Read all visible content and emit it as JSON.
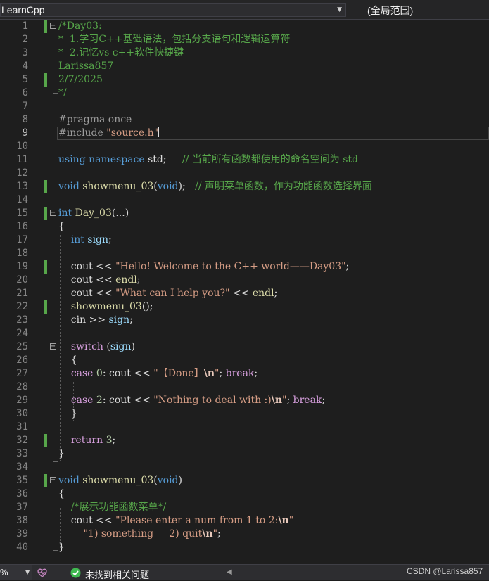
{
  "topbar": {
    "project_combo": "LearnCpp",
    "scope_combo": "(全局范围)"
  },
  "editor": {
    "lines": [
      {
        "n": "1",
        "spans": [
          [
            "cm",
            "/*Day03:"
          ]
        ]
      },
      {
        "n": "2",
        "spans": [
          [
            "cm",
            "*  1.学习C++基础语法，包括分支语句和逻辑运算符"
          ]
        ]
      },
      {
        "n": "3",
        "spans": [
          [
            "cm",
            "*  2.记忆vs c++软件快捷键"
          ]
        ]
      },
      {
        "n": "4",
        "spans": [
          [
            "cm",
            "Larissa857"
          ]
        ]
      },
      {
        "n": "5",
        "spans": [
          [
            "cm",
            "2/7/2025"
          ]
        ]
      },
      {
        "n": "6",
        "spans": [
          [
            "cm",
            "*/"
          ]
        ]
      },
      {
        "n": "7",
        "spans": []
      },
      {
        "n": "8",
        "spans": [
          [
            "pp",
            "#pragma once"
          ]
        ]
      },
      {
        "n": "9",
        "spans": [
          [
            "pp",
            "#include "
          ],
          [
            "str",
            "\"source.h\""
          ]
        ]
      },
      {
        "n": "10",
        "spans": []
      },
      {
        "n": "11",
        "spans": [
          [
            "kw",
            "using namespace "
          ],
          [
            "",
            "std;     "
          ],
          [
            "cm",
            "// 当前所有函数都使用的命名空间为 std"
          ]
        ]
      },
      {
        "n": "12",
        "spans": []
      },
      {
        "n": "13",
        "spans": [
          [
            "kw",
            "void "
          ],
          [
            "fn",
            "showmenu_03"
          ],
          [
            "",
            "("
          ],
          [
            "kw",
            "void"
          ],
          [
            "",
            ");   "
          ],
          [
            "cm",
            "// 声明菜单函数，作为功能函数选择界面"
          ]
        ]
      },
      {
        "n": "14",
        "spans": []
      },
      {
        "n": "15",
        "spans": [
          [
            "kw",
            "int "
          ],
          [
            "fn",
            "Day_03"
          ],
          [
            "",
            "(...)"
          ]
        ]
      },
      {
        "n": "16",
        "spans": [
          [
            "",
            "{"
          ]
        ]
      },
      {
        "n": "17",
        "spans": [
          [
            "",
            "    "
          ],
          [
            "kw",
            "int "
          ],
          [
            "var",
            "sign"
          ],
          [
            "",
            ";"
          ]
        ]
      },
      {
        "n": "18",
        "spans": []
      },
      {
        "n": "19",
        "spans": [
          [
            "",
            "    cout << "
          ],
          [
            "str",
            "\"Hello! Welcome to the C++ world——Day03\""
          ],
          [
            "",
            ";"
          ]
        ]
      },
      {
        "n": "20",
        "spans": [
          [
            "",
            "    cout << "
          ],
          [
            "fn",
            "endl"
          ],
          [
            "",
            ";"
          ]
        ]
      },
      {
        "n": "21",
        "spans": [
          [
            "",
            "    cout << "
          ],
          [
            "str",
            "\"What can I help you?\""
          ],
          [
            "",
            " << "
          ],
          [
            "fn",
            "endl"
          ],
          [
            "",
            ";"
          ]
        ]
      },
      {
        "n": "22",
        "spans": [
          [
            "",
            "    "
          ],
          [
            "fn",
            "showmenu_03"
          ],
          [
            "",
            "();"
          ]
        ]
      },
      {
        "n": "23",
        "spans": [
          [
            "",
            "    cin >> "
          ],
          [
            "var",
            "sign"
          ],
          [
            "",
            ";"
          ]
        ]
      },
      {
        "n": "24",
        "spans": []
      },
      {
        "n": "25",
        "spans": [
          [
            "",
            "    "
          ],
          [
            "fl",
            "switch"
          ],
          [
            "",
            " ("
          ],
          [
            "var",
            "sign"
          ],
          [
            "",
            ")"
          ]
        ]
      },
      {
        "n": "26",
        "spans": [
          [
            "",
            "    {"
          ]
        ]
      },
      {
        "n": "27",
        "spans": [
          [
            "",
            "    "
          ],
          [
            "fl",
            "case "
          ],
          [
            "num",
            "0"
          ],
          [
            "",
            ": cout << "
          ],
          [
            "str",
            "\"【Done】"
          ],
          [
            "esc",
            "\\n"
          ],
          [
            "str",
            "\""
          ],
          [
            "",
            "; "
          ],
          [
            "fl",
            "break"
          ],
          [
            "",
            ";"
          ]
        ]
      },
      {
        "n": "28",
        "spans": []
      },
      {
        "n": "29",
        "spans": [
          [
            "",
            "    "
          ],
          [
            "fl",
            "case "
          ],
          [
            "num",
            "2"
          ],
          [
            "",
            ": cout << "
          ],
          [
            "str",
            "\"Nothing to deal with :)"
          ],
          [
            "esc",
            "\\n"
          ],
          [
            "str",
            "\""
          ],
          [
            "",
            "; "
          ],
          [
            "fl",
            "break"
          ],
          [
            "",
            ";"
          ]
        ]
      },
      {
        "n": "30",
        "spans": [
          [
            "",
            "    }"
          ]
        ]
      },
      {
        "n": "31",
        "spans": []
      },
      {
        "n": "32",
        "spans": [
          [
            "",
            "    "
          ],
          [
            "fl",
            "return "
          ],
          [
            "num",
            "3"
          ],
          [
            "",
            ";"
          ]
        ]
      },
      {
        "n": "33",
        "spans": [
          [
            "",
            "}"
          ]
        ]
      },
      {
        "n": "34",
        "spans": []
      },
      {
        "n": "35",
        "spans": [
          [
            "kw",
            "void "
          ],
          [
            "fn",
            "showmenu_03"
          ],
          [
            "",
            "("
          ],
          [
            "kw",
            "void"
          ],
          [
            "",
            ")"
          ]
        ]
      },
      {
        "n": "36",
        "spans": [
          [
            "",
            "{"
          ]
        ]
      },
      {
        "n": "37",
        "spans": [
          [
            "",
            "    "
          ],
          [
            "cm",
            "/*展示功能函数菜单*/"
          ]
        ]
      },
      {
        "n": "38",
        "spans": [
          [
            "",
            "    cout << "
          ],
          [
            "str",
            "\"Please enter a num from 1 to 2:"
          ],
          [
            "esc",
            "\\n"
          ],
          [
            "str",
            "\""
          ]
        ]
      },
      {
        "n": "39",
        "spans": [
          [
            "str",
            "        \"1) something     2) quit"
          ],
          [
            "esc",
            "\\n"
          ],
          [
            "str",
            "\""
          ],
          [
            "",
            ";"
          ]
        ]
      },
      {
        "n": "40",
        "spans": [
          [
            "",
            "}"
          ]
        ]
      }
    ],
    "changed_lines": [
      1,
      5,
      13,
      15,
      19,
      22,
      32,
      35
    ],
    "fold_lines": [
      1,
      15,
      25,
      35
    ],
    "active_line": 9
  },
  "statusbar": {
    "zoom": "%",
    "issues_text": "未找到相关问题",
    "watermark": "CSDN @Larissa857",
    "accent_ok": "#3fb950"
  }
}
